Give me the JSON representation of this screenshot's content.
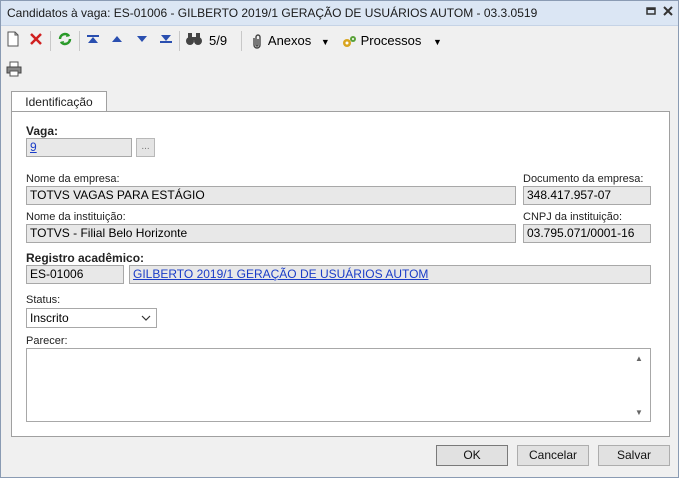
{
  "window": {
    "title": "Candidatos à vaga: ES-01006 - GILBERTO 2019/1 GERAÇÃO DE USUÁRIOS AUTOM - 03.3.0519"
  },
  "toolbar": {
    "record_counter": "5/9",
    "attachments_label": "Anexos",
    "processes_label": "Processos"
  },
  "tabs": [
    {
      "label": "Identificação"
    }
  ],
  "form": {
    "vaga_label": "Vaga:",
    "vaga_value": "9",
    "lookup_label": "...",
    "empresa_label": "Nome da empresa:",
    "empresa_value": "TOTVS VAGAS PARA ESTÁGIO",
    "doc_empresa_label": "Documento da empresa:",
    "doc_empresa_value": "348.417.957-07",
    "instituicao_label": "Nome da instituição:",
    "instituicao_value": "TOTVS - Filial Belo Horizonte",
    "cnpj_label": "CNPJ da instituição:",
    "cnpj_value": "03.795.071/0001-16",
    "registro_label": "Registro acadêmico:",
    "registro_code": "ES-01006",
    "registro_name": "GILBERTO 2019/1 GERAÇÃO DE USUÁRIOS AUTOM",
    "status_label": "Status:",
    "status_value": "Inscrito",
    "parecer_label": "Parecer:",
    "parecer_value": ""
  },
  "footer": {
    "ok_label": "OK",
    "cancel_label": "Cancelar",
    "save_label": "Salvar"
  },
  "colors": {
    "titlebar": "#dbe6f4",
    "link": "#1a3cc8",
    "field_bg": "#e8e8e8"
  }
}
